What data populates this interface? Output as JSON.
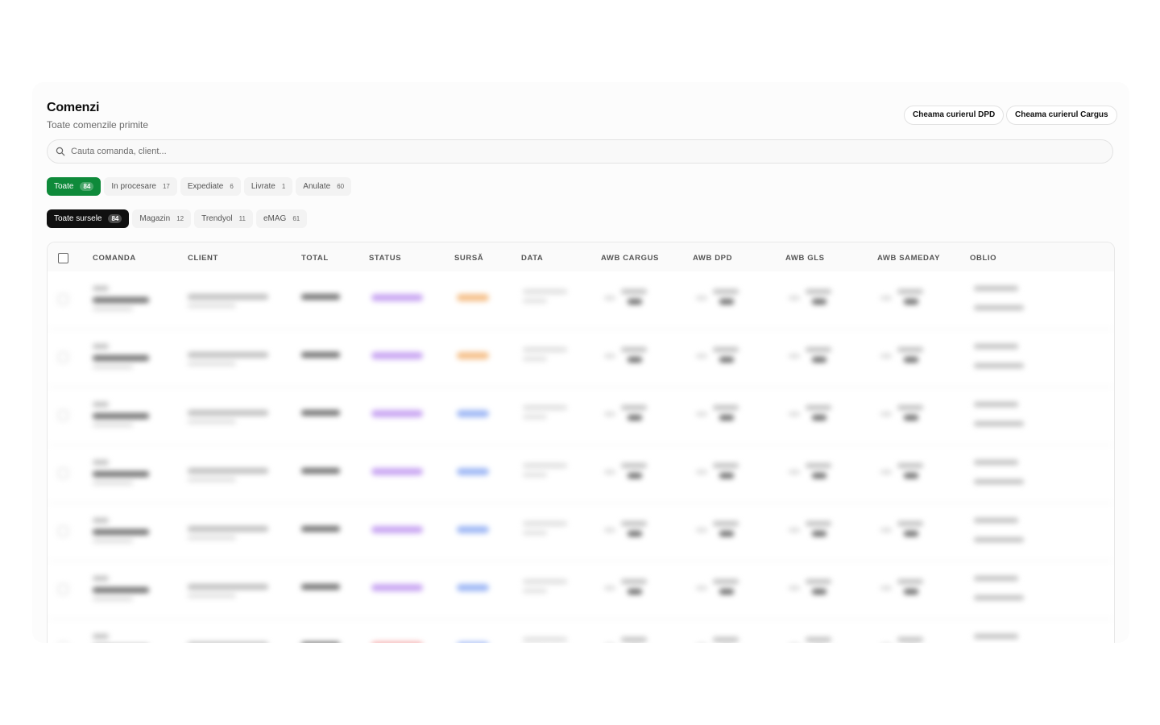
{
  "header": {
    "title": "Comenzi",
    "subtitle": "Toate comenzile primite",
    "buttons": {
      "dpd": "Cheama curierul DPD",
      "cargus": "Cheama curierul Cargus"
    }
  },
  "search": {
    "placeholder": "Cauta comanda, client..."
  },
  "status_filters": [
    {
      "label": "Toate",
      "count": "84",
      "active": true
    },
    {
      "label": "In procesare",
      "count": "17",
      "active": false
    },
    {
      "label": "Expediate",
      "count": "6",
      "active": false
    },
    {
      "label": "Livrate",
      "count": "1",
      "active": false
    },
    {
      "label": "Anulate",
      "count": "60",
      "active": false
    }
  ],
  "source_filters": [
    {
      "label": "Toate sursele",
      "count": "84",
      "active": true
    },
    {
      "label": "Magazin",
      "count": "12",
      "active": false
    },
    {
      "label": "Trendyol",
      "count": "11",
      "active": false
    },
    {
      "label": "eMAG",
      "count": "61",
      "active": false
    }
  ],
  "table": {
    "columns": [
      "COMANDA",
      "CLIENT",
      "TOTAL",
      "STATUS",
      "SURSĂ",
      "DATA",
      "AWB CARGUS",
      "AWB DPD",
      "AWB GLS",
      "AWB SAMEDAY",
      "OBLIO"
    ],
    "row_status_colors": [
      "#c9a6f2",
      "#c9a6f2",
      "#c9a6f2",
      "#c9a6f2",
      "#c9a6f2",
      "#c9a6f2",
      "#f2a6a6"
    ],
    "row_source_colors": [
      "#f5c08a",
      "#f5c08a",
      "#9fb8f5",
      "#9fb8f5",
      "#9fb8f5",
      "#9fb8f5",
      "#9fb8f5"
    ]
  },
  "colors": {
    "accent_green": "#0e8a3a",
    "active_dark": "#101010"
  }
}
